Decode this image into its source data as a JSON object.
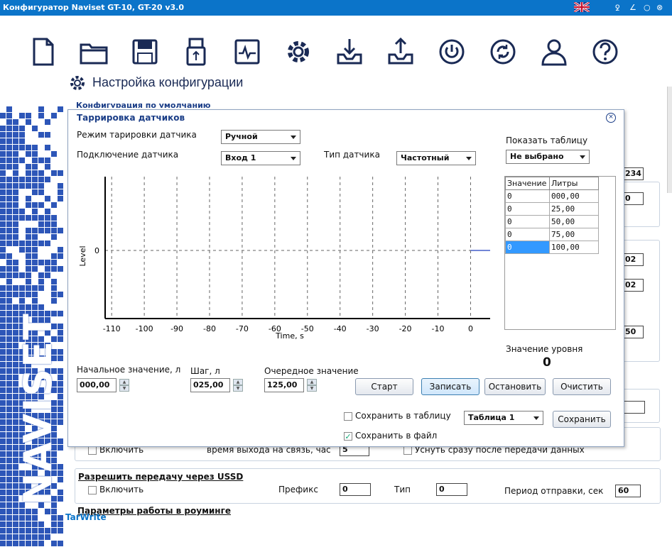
{
  "app": {
    "title": "Конфигуратор Naviset GT-10, GT-20 v3.0",
    "status": "TarWrite",
    "tray_icons": [
      "ꝿ",
      "∠",
      "○",
      "⊗"
    ]
  },
  "toolbar": {
    "tools": [
      "new-file-icon",
      "open-folder-icon",
      "save-disk-icon",
      "usb-icon",
      "monitor-icon",
      "settings-gear-icon",
      "download-icon",
      "upload-icon",
      "power-icon",
      "refresh-icon",
      "user-icon",
      "help-icon"
    ]
  },
  "page": {
    "section_title": "Настройка конфигурации",
    "behind_label": "Конфигурация по умолчанию"
  },
  "background": {
    "field_234": "234",
    "field_0": "0",
    "field_02a": "02",
    "field_02b": "02",
    "field_50": "50",
    "partial_include": "Включить",
    "partial_time": "время выхода на связь, час",
    "partial_field": "5",
    "partial_sleep": "Уснуть сразу после передачи данных",
    "ussd": {
      "title": "Разрешить передачу через USSD",
      "enable": "Включить",
      "prefix_label": "Префикс",
      "prefix_value": "0",
      "type_label": "Тип",
      "type_value": "0",
      "period_label": "Период отправки, сек",
      "period_value": "60"
    },
    "roaming_title": "Параметры работы в роуминге"
  },
  "dialog": {
    "title": "Таррировка датчиков",
    "mode_label": "Режим тарировки датчика",
    "mode_value": "Ручной",
    "connect_label": "Подключение датчика",
    "connect_value": "Вход 1",
    "type_label": "Тип датчика",
    "type_value": "Частотный",
    "show_table_label": "Показать таблицу",
    "show_table_value": "Не выбрано",
    "table": {
      "headers": [
        "Значение",
        "Литры"
      ],
      "rows": [
        [
          "0",
          "000,00"
        ],
        [
          "0",
          "25,00"
        ],
        [
          "0",
          "50,00"
        ],
        [
          "0",
          "75,00"
        ],
        [
          "0",
          "100,00"
        ]
      ]
    },
    "level_label": "Значение уровня",
    "level_value": "0",
    "start_label": "Начальное значение, л",
    "start_value": "000,00",
    "step_label": "Шаг, л",
    "step_value": "025,00",
    "next_label": "Очередное значение",
    "next_value": "125,00",
    "btn_start": "Старт",
    "btn_write": "Записать",
    "btn_stop": "Остановить",
    "btn_clear": "Очистить",
    "save_table_label": "Сохранить в таблицу",
    "save_file_label": "Сохранить в файл",
    "table_select": "Таблица 1",
    "btn_save": "Сохранить"
  },
  "chart_data": {
    "type": "line",
    "xlabel": "Time, s",
    "ylabel": "Level",
    "x_ticks": [
      -110,
      -100,
      -90,
      -80,
      -70,
      -60,
      -50,
      -40,
      -30,
      -20,
      -10,
      0
    ],
    "y_ticks": [
      0
    ],
    "xlim": [
      -112,
      6
    ],
    "grid": "vertical dashed + horizontal dashed at 0",
    "series": [
      {
        "x": [
          0,
          6
        ],
        "y": [
          0,
          0
        ],
        "color": "#1f3fbf"
      }
    ]
  }
}
